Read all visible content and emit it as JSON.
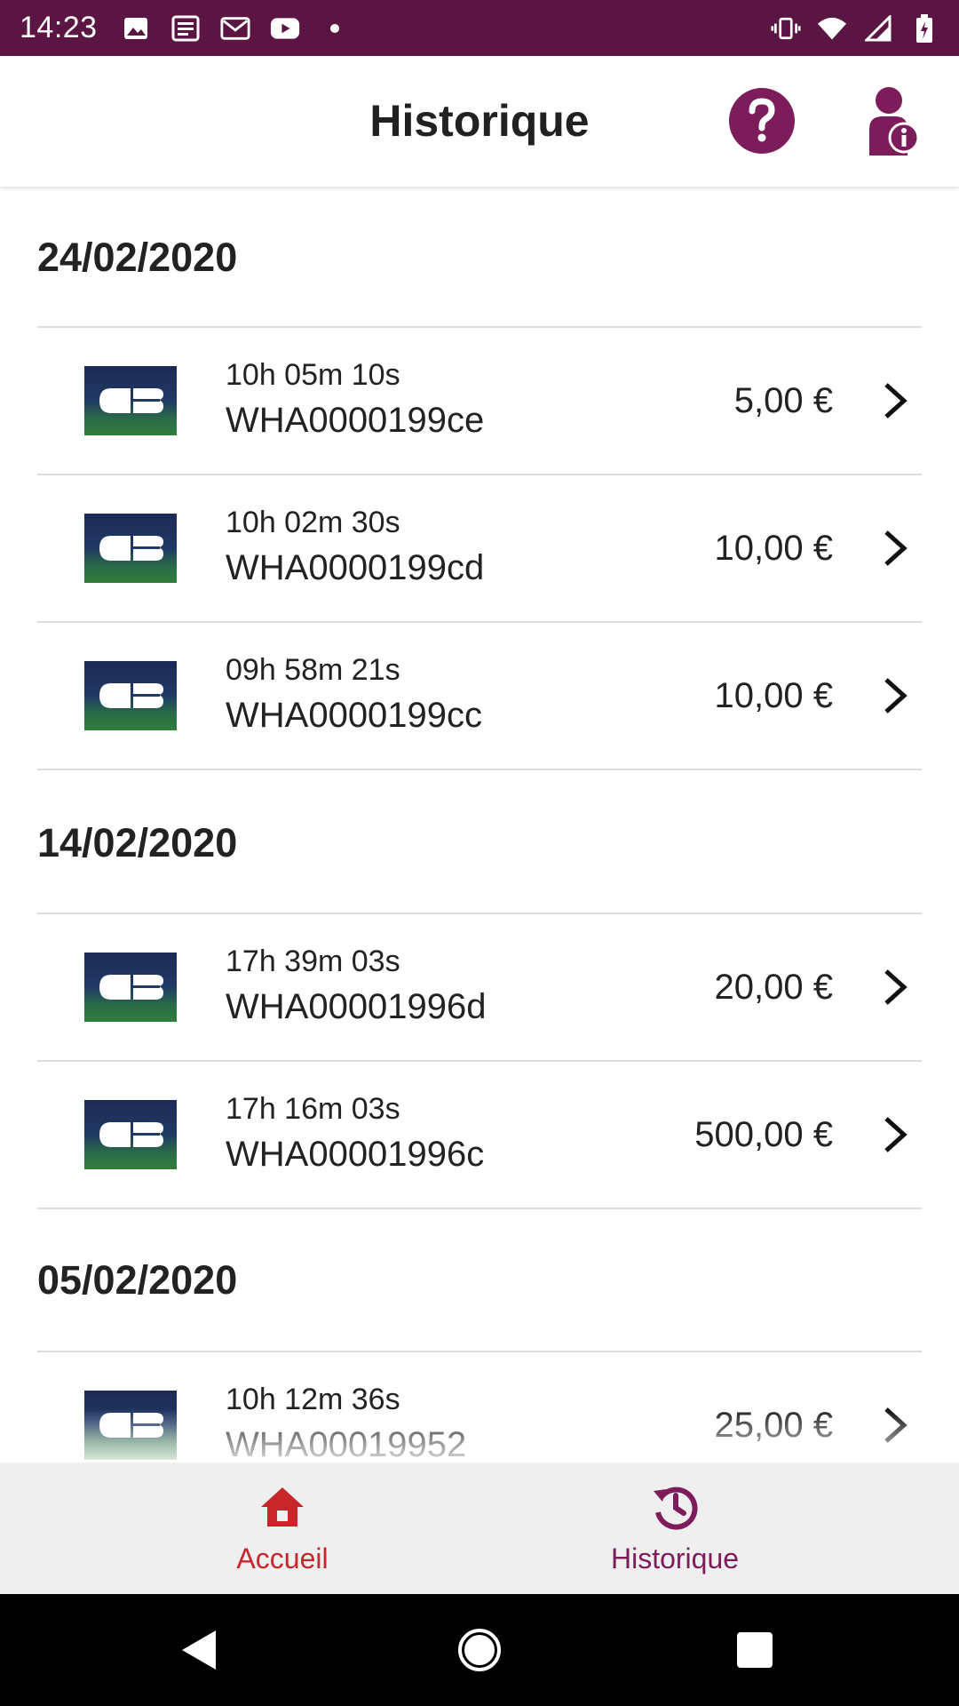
{
  "status_bar": {
    "time": "14:23",
    "left_icons": [
      "image-icon",
      "news-icon",
      "gmail-icon",
      "youtube-icon",
      "dot-icon"
    ],
    "right_icons": [
      "vibrate-icon",
      "wifi-icon",
      "signal-icon",
      "battery-icon"
    ]
  },
  "app_bar": {
    "title": "Historique",
    "help_icon": "help-icon",
    "profile_icon": "user-info-icon"
  },
  "history": {
    "groups": [
      {
        "date": "24/02/2020",
        "transactions": [
          {
            "time": "10h 05m 10s",
            "id": "WHA0000199ce",
            "amount": "5,00 €"
          },
          {
            "time": "10h 02m 30s",
            "id": "WHA0000199cd",
            "amount": "10,00 €"
          },
          {
            "time": "09h 58m 21s",
            "id": "WHA0000199cc",
            "amount": "10,00 €"
          }
        ]
      },
      {
        "date": "14/02/2020",
        "transactions": [
          {
            "time": "17h 39m 03s",
            "id": "WHA00001996d",
            "amount": "20,00 €"
          },
          {
            "time": "17h 16m 03s",
            "id": "WHA00001996c",
            "amount": "500,00 €"
          }
        ]
      },
      {
        "date": "05/02/2020",
        "transactions": [
          {
            "time": "10h 12m 36s",
            "id": "WHA00019952",
            "amount": "25,00 €"
          }
        ]
      }
    ]
  },
  "bottom_nav": {
    "accueil": "Accueil",
    "historique": "Historique"
  },
  "colors": {
    "status_bar": "#5b1543",
    "brand": "#7d1c5b",
    "accueil": "#c8262b",
    "cb_top": "#1d2a55",
    "cb_bottom": "#2f7d3a"
  }
}
